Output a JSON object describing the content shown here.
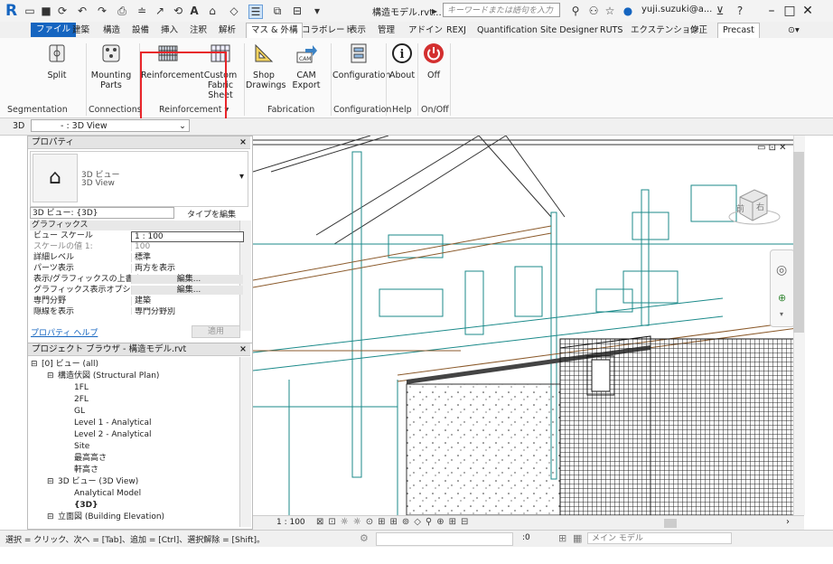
{
  "titlebar": {
    "document_title": "構造モデル.rvt...",
    "search_placeholder": "キーワードまたは語句を入力",
    "user": "yuji.suzuki@a..."
  },
  "tabs": [
    {
      "label": "ファイル"
    },
    {
      "label": "建築"
    },
    {
      "label": "構造"
    },
    {
      "label": "設備"
    },
    {
      "label": "挿入"
    },
    {
      "label": "注釈"
    },
    {
      "label": "解析"
    },
    {
      "label": "マス & 外構"
    },
    {
      "label": "コラボレート"
    },
    {
      "label": "表示"
    },
    {
      "label": "管理"
    },
    {
      "label": "アドイン"
    },
    {
      "label": "REXJ"
    },
    {
      "label": "Quantification"
    },
    {
      "label": "Site Designer"
    },
    {
      "label": "RUTS"
    },
    {
      "label": "エクステンション"
    },
    {
      "label": "修正"
    },
    {
      "label": "Precast"
    }
  ],
  "ribbon": {
    "buttons": {
      "split": "Split",
      "mounting_parts": "Mounting Parts",
      "reinforcement": "Reinforcement",
      "custom_fabric_sheet": "Custom Fabric Sheet",
      "shop_drawings": "Shop Drawings",
      "cam_export": "CAM Export",
      "configuration": "Configuration",
      "about": "About",
      "off": "Off"
    },
    "panels": {
      "segmentation": "Segmentation",
      "connections": "Connections",
      "reinforcement": "Reinforcement ▾",
      "fabrication": "Fabrication",
      "configuration": "Configuration",
      "help": "Help",
      "onoff": "On/Off"
    }
  },
  "viewselector": {
    "prefix": "3D",
    "value": "- : 3D View"
  },
  "properties": {
    "title": "プロパティ",
    "type_name": "3D ビュー",
    "type_sub": "3D View",
    "instance": "3D ビュー: {3D}",
    "edit_type": "タイプを編集",
    "group": "グラフィックス",
    "rows": [
      {
        "k": "ビュー スケール",
        "v": "1 : 100"
      },
      {
        "k": "スケールの値  1:",
        "v": "100"
      },
      {
        "k": "詳細レベル",
        "v": "標準"
      },
      {
        "k": "パーツ表示",
        "v": "両方を表示"
      },
      {
        "k": "表示/グラフィックスの上書き",
        "v": "編集..."
      },
      {
        "k": "グラフィックス表示オプション",
        "v": "編集..."
      },
      {
        "k": "専門分野",
        "v": "建築"
      },
      {
        "k": "隠線を表示",
        "v": "専門分野別"
      }
    ],
    "help_link": "プロパティ ヘルプ",
    "apply": "適用"
  },
  "browser": {
    "title": "プロジェクト ブラウザ - 構造モデル.rvt",
    "items": [
      "[0] ビュー (all)",
      "構造伏図 (Structural Plan)",
      "1FL",
      "2FL",
      "GL",
      "Level 1 - Analytical",
      "Level 2 - Analytical",
      "Site",
      "最高高さ",
      "軒高さ",
      "3D ビュー (3D View)",
      "Analytical Model",
      "{3D}",
      "立面図 (Building Elevation)"
    ]
  },
  "viewcube": {
    "front": "前",
    "right": "右"
  },
  "viewbar": {
    "scale": "1 : 100"
  },
  "status": {
    "hint": "選択 = クリック、次へ = [Tab]、追加 = [Ctrl]、選択解除 = [Shift]。",
    "count": ":0",
    "model": "メイン モデル"
  },
  "colors": {
    "accent": "#1565c0",
    "highlight": "#e8252a",
    "off": "#d32f2f"
  }
}
